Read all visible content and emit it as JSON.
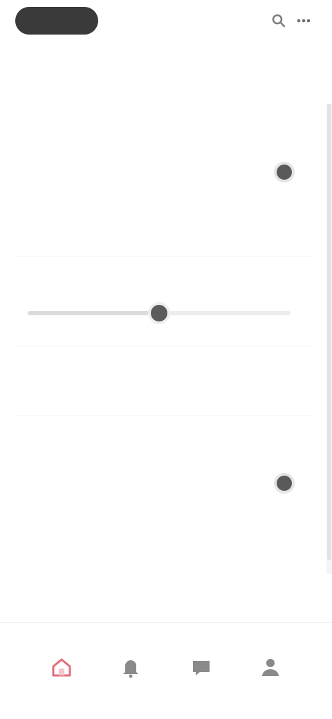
{
  "header": {
    "back_label": "",
    "icons": [
      "search-icon",
      "more-icon"
    ]
  },
  "page": {
    "title": ""
  },
  "sections": [
    {
      "title": "",
      "hint": "",
      "row_label": "",
      "row_value": "",
      "toggle_on": true
    },
    {
      "title": "",
      "hint": "",
      "row_label": "",
      "row_value": "",
      "toggle_on": true
    }
  ],
  "slider": {
    "value_fraction": 0.5,
    "caption": ""
  },
  "bottom_nav": {
    "items": [
      {
        "icon": "home-icon",
        "label": "",
        "active": true
      },
      {
        "icon": "bell-icon",
        "label": "",
        "active": false
      },
      {
        "icon": "chat-icon",
        "label": "",
        "active": false
      },
      {
        "icon": "profile-icon",
        "label": "",
        "active": false
      }
    ],
    "active_color": "#e36b7a",
    "inactive_color": "#7a7a7a"
  }
}
